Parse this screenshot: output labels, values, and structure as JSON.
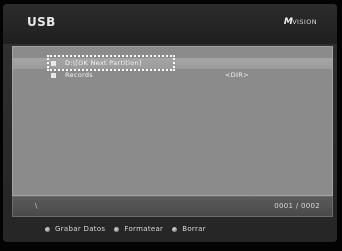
{
  "header": {
    "title": "USB",
    "brand_mark": "M",
    "brand_text": "VISION"
  },
  "files": {
    "items": [
      {
        "name": "D:\\[OK Next Partition]",
        "type": ""
      },
      {
        "name": "Records",
        "type": "<DIR>"
      }
    ],
    "focused_index": 0
  },
  "status": {
    "path": "\\",
    "count": "0001 / 0002"
  },
  "footer": {
    "actions": [
      {
        "label": "Grabar Datos",
        "color": "#bdbdbd"
      },
      {
        "label": "Formatear",
        "color": "#bdbdbd"
      },
      {
        "label": "Borrar",
        "color": "#bdbdbd"
      }
    ]
  }
}
